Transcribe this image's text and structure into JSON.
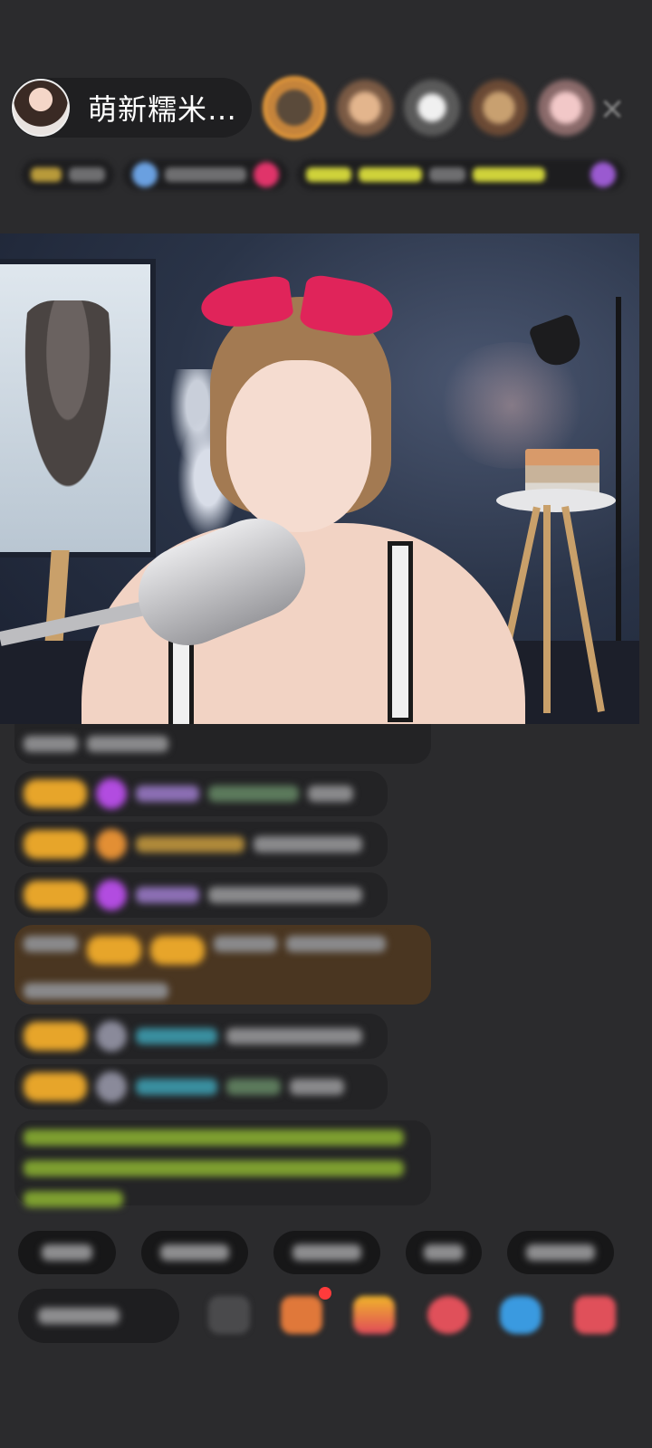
{
  "header": {
    "host_name": "萌新糯米…"
  },
  "colors": {
    "background": "#2b2b2d",
    "level_badge": "#e7a52a",
    "accent_red": "#e0245a"
  },
  "icons": {
    "close": "×"
  }
}
